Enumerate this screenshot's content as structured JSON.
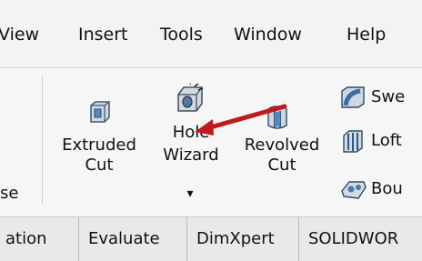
{
  "menu": {
    "items": [
      "View",
      "Insert",
      "Tools",
      "Window",
      "Help"
    ]
  },
  "ribbon": {
    "left_partial_label": "se",
    "extruded_cut": {
      "line1": "Extruded",
      "line2": "Cut",
      "icon": "extruded-cut-icon"
    },
    "hole_wizard": {
      "line1": "Hole",
      "line2": "Wizard",
      "icon": "hole-wizard-icon",
      "dropdown": "▾"
    },
    "revolved_cut": {
      "line1": "Revolved",
      "line2": "Cut",
      "icon": "revolved-cut-icon"
    },
    "right_column": {
      "swept": {
        "label": "Swe",
        "icon": "swept-cut-icon"
      },
      "lofted": {
        "label": "Loft",
        "icon": "lofted-cut-icon"
      },
      "boundary": {
        "label": "Bou",
        "icon": "boundary-cut-icon"
      }
    }
  },
  "tabs": [
    "ation",
    "Evaluate",
    "DimXpert",
    "SOLIDWOR"
  ],
  "annotation": {
    "arrow_color": "#c0191e"
  }
}
